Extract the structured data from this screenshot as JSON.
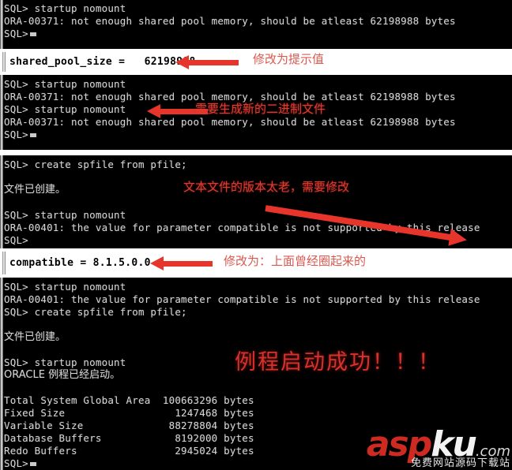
{
  "panels": [
    {
      "id": "console-1",
      "type": "console",
      "lines": [
        "SQL> startup nomount",
        "ORA-00371: not enough shared pool memory, should be atleast 62198988 bytes",
        "SQL>"
      ]
    },
    {
      "id": "editor-1",
      "type": "editor",
      "text": "shared_pool_size =   62198988"
    },
    {
      "id": "console-2",
      "type": "console",
      "lines": [
        "SQL> startup nomount",
        "ORA-00371: not enough shared pool memory, should be atleast 62198988 bytes",
        "SQL> startup nomount",
        "ORA-00371: not enough shared pool memory, should be atleast 62198988 bytes",
        "SQL>"
      ]
    },
    {
      "id": "console-3",
      "type": "console",
      "lines": [
        "SQL> create spfile from pfile;",
        "",
        "文件已创建。",
        "",
        "SQL> startup nomount",
        "ORA-00401: the value for parameter compatible is not supported by this release",
        "SQL>"
      ]
    },
    {
      "id": "editor-2",
      "type": "editor",
      "text": "compatible = 8.1.5.0.0"
    },
    {
      "id": "console-4",
      "type": "console",
      "lines": [
        "SQL> startup nomount",
        "ORA-00401: the value for parameter compatible is not supported by this release",
        "SQL> create spfile from pfile;",
        "",
        "文件已创建。",
        "",
        "SQL> startup nomount",
        "ORACLE 例程已经启动。",
        "",
        "Total System Global Area  100663296 bytes",
        "Fixed Size                  1247468 bytes",
        "Variable Size              88278804 bytes",
        "Database Buffers            8192000 bytes",
        "Redo Buffers                2945024 bytes",
        "SQL>"
      ]
    }
  ],
  "annotations": {
    "a1": "修改为提示值",
    "a2": "需要生成新的二进制文件",
    "a3": "文本文件的版本太老，需要修改",
    "a4": "修改为：上面曾经圈起来的",
    "a5": "例程启动成功！！！"
  },
  "watermark": {
    "brand_red": "asp",
    "brand_white": "ku",
    "tld": ".com",
    "tagline": "免费网站源码下载站"
  },
  "colors": {
    "console_bg": "#000000",
    "console_text": "#d4d4d4",
    "editor_bg": "#ffffff",
    "editor_text": "#000000",
    "annotation_red": "#e23a2e",
    "arrow_red": "#e8352b",
    "brand_red": "#cf2a22"
  }
}
